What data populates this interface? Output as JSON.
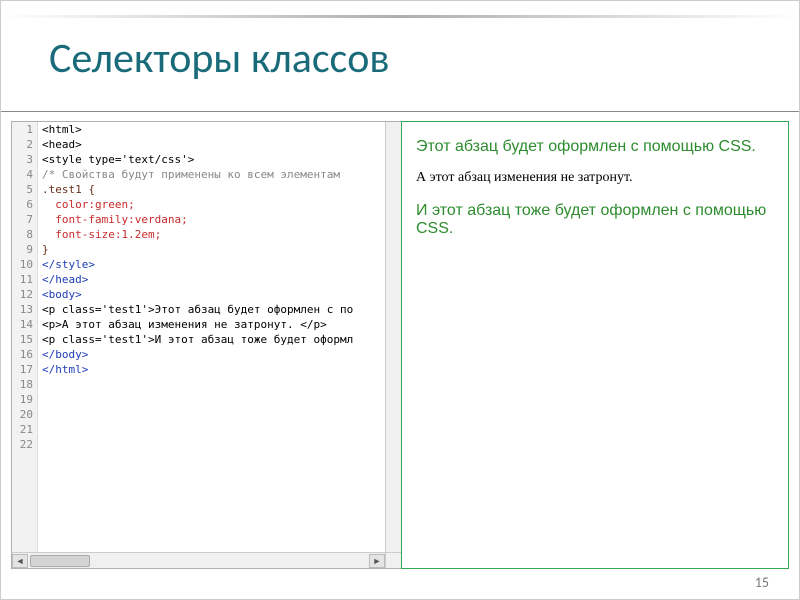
{
  "slide": {
    "title": "Селекторы классов",
    "page_number": "15"
  },
  "code": {
    "lines": [
      "<html>",
      "<head>",
      "<style type='text/css'>",
      "/* Свойства будут применены ко всем элементам ",
      ".test1 {",
      "  color:green;",
      "  font-family:verdana;",
      "  font-size:1.2em;",
      "}",
      "</style>",
      "</head>",
      "<body>",
      "",
      "<p class='test1'>Этот абзац будет оформлен с по",
      "",
      "<p>А этот абзац изменения не затронут. </p>",
      "",
      "<p class='test1'>И этот абзац тоже будет оформл",
      "",
      "</body>",
      "</html>",
      ""
    ]
  },
  "preview": {
    "p1": "Этот абзац будет оформлен с помощью CSS.",
    "p2": "А этот абзац изменения не затронут.",
    "p3": "И этот абзац тоже будет оформлен с помощью CSS."
  }
}
